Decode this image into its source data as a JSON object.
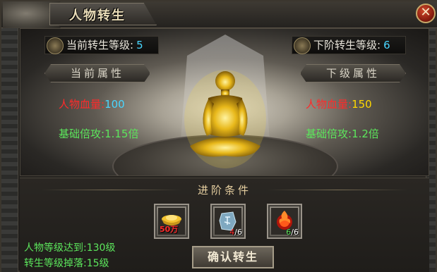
{
  "window": {
    "title": "人物转生",
    "close_glyph": "✕"
  },
  "scene": {
    "current_level_label": "当前转生等级:",
    "current_level_value": "5",
    "next_level_label": "下阶转生等级:",
    "next_level_value": "6",
    "current_attr_title": "当前属性",
    "next_attr_title": "下级属性",
    "current_stats": [
      {
        "key": "人物血量:",
        "value": "100"
      },
      {
        "key": "基础倍攻:",
        "value": "1.15倍"
      }
    ],
    "next_stats": [
      {
        "key": "人物血量:",
        "value": "150"
      },
      {
        "key": "基础倍攻:",
        "value": "1.2倍"
      }
    ]
  },
  "conditions": {
    "title": "进阶条件",
    "items": [
      {
        "icon": "gold-ingot-icon",
        "badge": "50万",
        "have": "",
        "need": ""
      },
      {
        "icon": "rune-stone-icon",
        "badge": "",
        "have": "4",
        "need": "/6"
      },
      {
        "icon": "fire-orb-icon",
        "badge": "",
        "have": "6",
        "need": "/6"
      }
    ],
    "requirements": [
      {
        "label": "人物等级达到:",
        "value": "130级"
      },
      {
        "label": "转生等级掉落:",
        "value": "15级"
      }
    ],
    "confirm_label": "确认转生"
  },
  "colors": {
    "red": "#ff2a2a",
    "cyan": "#49d6ff",
    "green": "#5ce65c",
    "yellow": "#ffd800",
    "gold_title": "#e9dcb8"
  }
}
